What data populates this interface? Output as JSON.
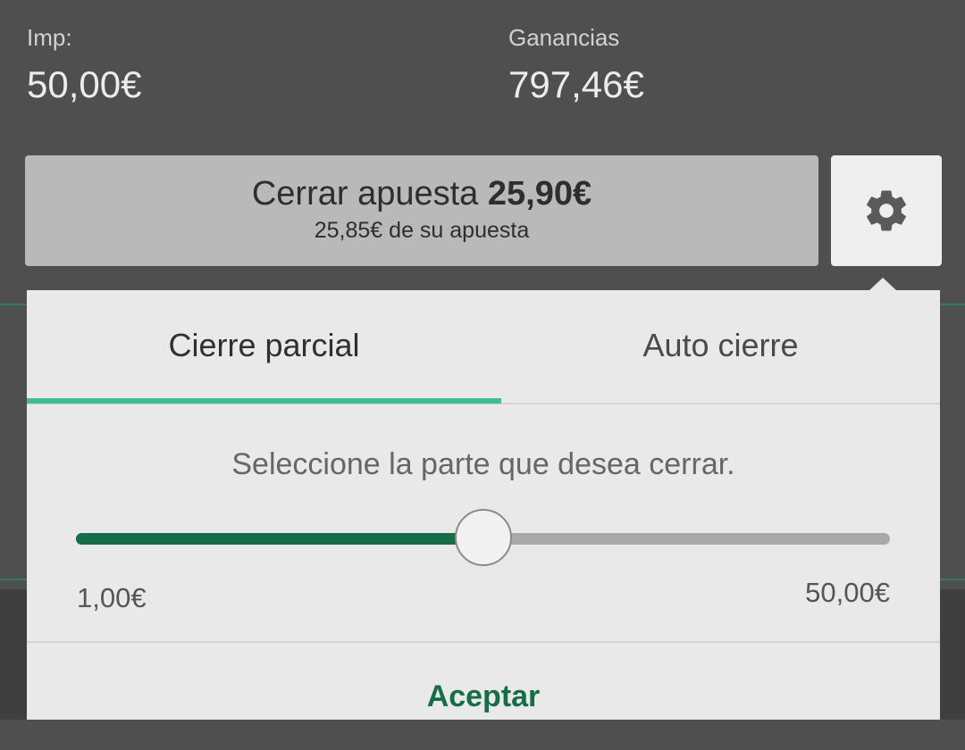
{
  "bet": {
    "stake_label": "Imp:",
    "stake_value": "50,00€",
    "winnings_label": "Ganancias",
    "winnings_value": "797,46€"
  },
  "cashout": {
    "label": "Cerrar apuesta",
    "amount": "25,90€",
    "subtext": "25,85€ de su apuesta"
  },
  "settings": {
    "icon": "gear-icon"
  },
  "popover": {
    "tabs": [
      {
        "label": "Cierre parcial",
        "active": true
      },
      {
        "label": "Auto cierre",
        "active": false
      }
    ],
    "instruction": "Seleccione la parte que desea cerrar.",
    "slider": {
      "min_label": "1,00€",
      "max_label": "50,00€",
      "position_fraction": 0.5
    },
    "accept_label": "Aceptar"
  },
  "colors": {
    "accent_green": "#176c49",
    "tab_indicator": "#3fbf91",
    "background_dark": "#4f4f4f"
  }
}
